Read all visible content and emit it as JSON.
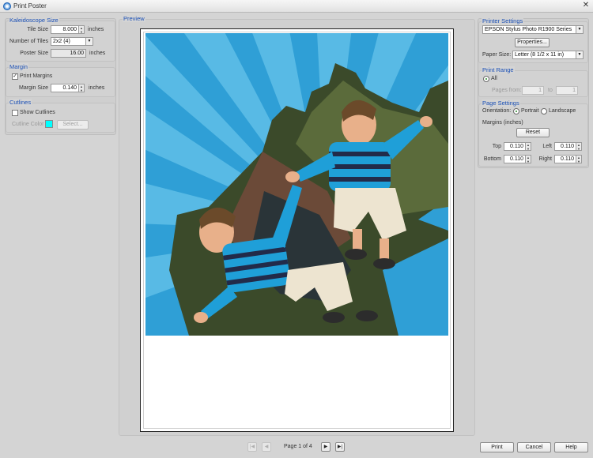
{
  "window": {
    "title": "Print Poster",
    "close_glyph": "✕"
  },
  "kaleidoscope": {
    "group_label": "Kaleidoscope Size",
    "tile_size_label": "Tile Size",
    "tile_size_value": "8.000",
    "tile_size_unit": "inches",
    "tiles_label": "Number of Tiles",
    "tiles_value": "2x2 (4)",
    "poster_size_label": "Poster Size",
    "poster_size_value": "16.00",
    "poster_size_unit": "inches"
  },
  "margin": {
    "group_label": "Margin",
    "print_margins_label": "Print Margins",
    "print_margins_checked": true,
    "margin_size_label": "Margin Size",
    "margin_size_value": "0.140",
    "margin_size_unit": "inches"
  },
  "cutlines": {
    "group_label": "Cutlines",
    "show_cutlines_label": "Show Cutlines",
    "show_cutlines_checked": false,
    "cutline_color_label": "Cutline Color",
    "cutline_color": "#00ffff",
    "select_label": "Select..."
  },
  "preview": {
    "group_label": "Preview",
    "poster_bg": "#2f9fd6",
    "page_label": "Page 1 of 4",
    "first_glyph": "|◀",
    "prev_glyph": "◀",
    "next_glyph": "▶",
    "last_glyph": "▶|"
  },
  "printer": {
    "group_label": "Printer Settings",
    "printer_name": "EPSON Stylus Photo R1900 Series",
    "properties_label": "Properties...",
    "paper_size_label": "Paper Size:",
    "paper_size_value": "Letter (8 1/2 x 11 in)"
  },
  "print_range": {
    "group_label": "Print Range",
    "all_label": "All",
    "pages_from_label": "Pages from:",
    "from_value": "1",
    "to_label": "to",
    "to_value": "1"
  },
  "page_settings": {
    "group_label": "Page Settings",
    "orientation_label": "Orientation:",
    "portrait_label": "Portrait",
    "landscape_label": "Landscape",
    "margins_label": "Margins (inches)",
    "reset_label": "Reset",
    "top_label": "Top",
    "top_value": "0.110",
    "left_label": "Left",
    "left_value": "0.110",
    "bottom_label": "Bottom",
    "bottom_value": "0.110",
    "right_label": "Right",
    "right_value": "0.110"
  },
  "footer": {
    "print_label": "Print",
    "cancel_label": "Cancel",
    "help_label": "Help"
  },
  "icons": {
    "app": "poster-app-icon",
    "spin": "spin-arrows-icon",
    "dropdown": "chevron-down-icon"
  }
}
